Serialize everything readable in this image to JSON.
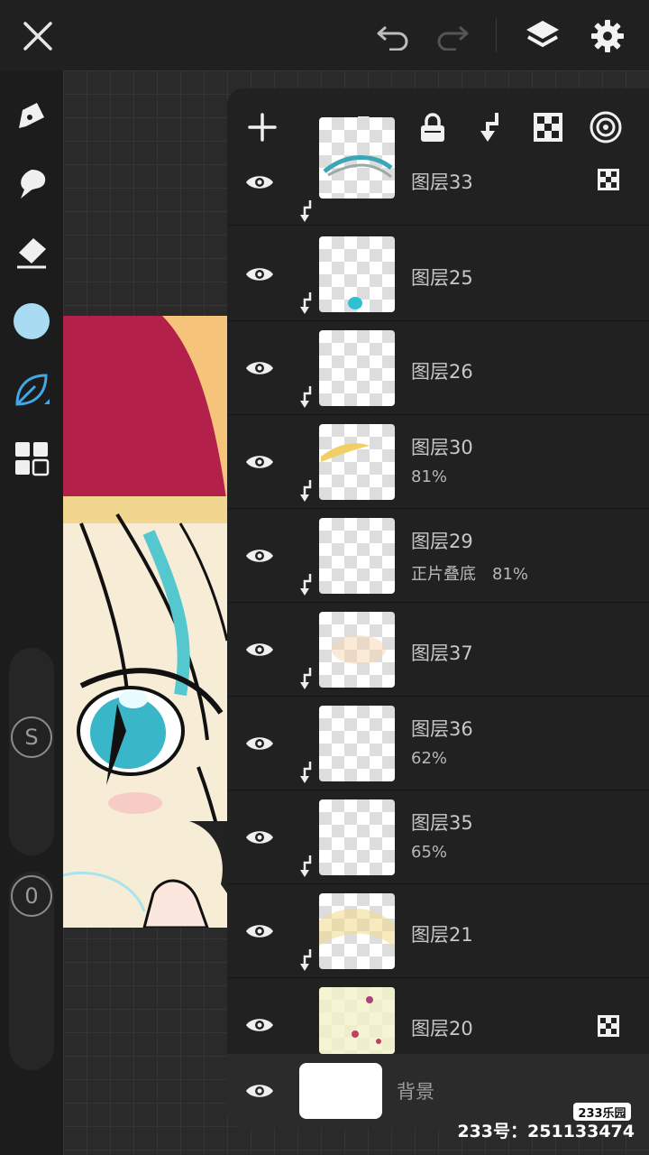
{
  "layers": [
    {
      "name": "图层33",
      "meta": "",
      "alpha_lock": true
    },
    {
      "name": "图层25",
      "meta": "",
      "alpha_lock": false
    },
    {
      "name": "图层26",
      "meta": "",
      "alpha_lock": false
    },
    {
      "name": "图层30",
      "meta": "81%",
      "alpha_lock": false
    },
    {
      "name": "图层29",
      "meta": "正片叠底　81%",
      "alpha_lock": false
    },
    {
      "name": "图层37",
      "meta": "",
      "alpha_lock": false
    },
    {
      "name": "图层36",
      "meta": "62%",
      "alpha_lock": false
    },
    {
      "name": "图层35",
      "meta": "65%",
      "alpha_lock": false
    },
    {
      "name": "图层21",
      "meta": "",
      "alpha_lock": false
    },
    {
      "name": "图层20",
      "meta": "",
      "alpha_lock": true
    }
  ],
  "background_layer": {
    "name": "背景"
  },
  "sliders": {
    "size_label": "S",
    "opacity_label": "0"
  },
  "current_color": "#a9dcf2",
  "accent_color": "#3fa9e8",
  "watermark": {
    "site": "233乐园",
    "id_text": "233号：251133474"
  },
  "icons": {
    "top": [
      "close-icon",
      "undo-icon",
      "redo-icon",
      "layers-icon",
      "settings-icon"
    ],
    "tools": [
      "pen-icon",
      "smudge-icon",
      "eraser-icon",
      "color-swatch",
      "brush-leaf-icon",
      "gallery-icon"
    ],
    "panel": [
      "add-icon",
      "folder-icon",
      "lock-icon",
      "clip-icon",
      "alpha-lock-icon",
      "blend-icon"
    ]
  }
}
